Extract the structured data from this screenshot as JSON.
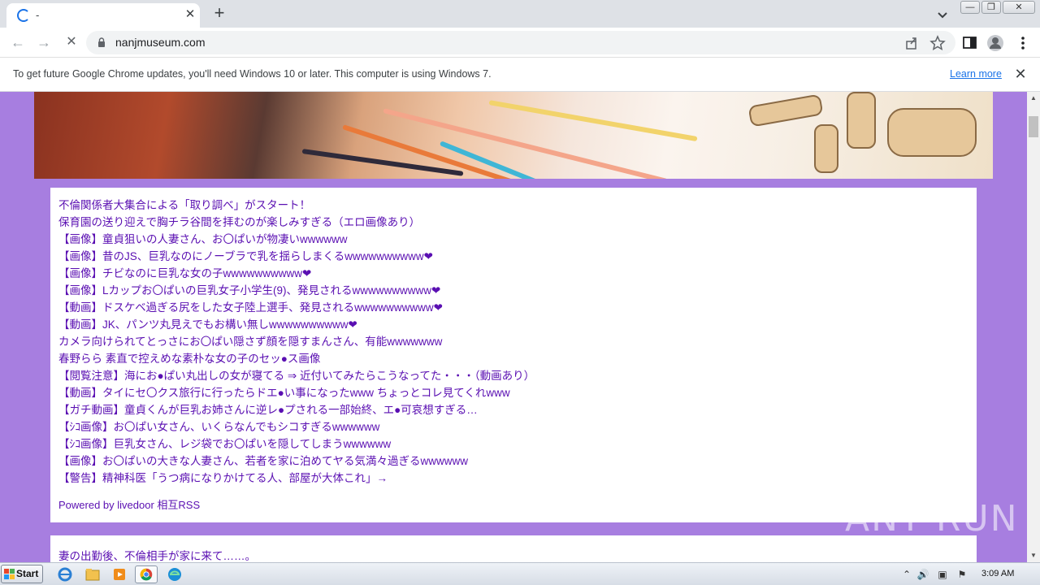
{
  "browser": {
    "tab_title": "-",
    "tab_close": "✕",
    "new_tab": "+",
    "url": "nanjmuseum.com",
    "back": "←",
    "forward": "→",
    "reload": "✕",
    "window_controls": {
      "minimize": "—",
      "restore": "❐",
      "close": "✕"
    }
  },
  "infobar": {
    "message": "To get future Google Chrome updates, you'll need Windows 10 or later. This computer is using Windows 7.",
    "link": "Learn more",
    "close": "✕"
  },
  "page": {
    "links": [
      "不倫関係者大集合による「取り調べ」がスタート！",
      "保育園の送り迎えで胸チラ谷間を拝むのが楽しみすぎる（エロ画像あり）",
      "【画像】童貞狙いの人妻さん、お〇ぱいが物凄いwwwwww",
      "【画像】昔のJS、巨乳なのにノーブラで乳を揺らしまくるwwwwwwwwww❤",
      "【画像】チビなのに巨乳な女の子wwwwwwwwww❤",
      "【画像】Lカップお〇ぱいの巨乳女子小学生(9)、発見されるwwwwwwwwww❤",
      "【動画】ドスケベ過ぎる尻をした女子陸上選手、発見されるwwwwwwwwww❤",
      "【動画】JK、パンツ丸見えでもお構い無しwwwwwwwwww❤",
      "カメラ向けられてとっさにお〇ぱい隠さず顔を隠すまんさん、有能wwwwwww",
      "春野らら 素直で控えめな素朴な女の子のセッ●ス画像",
      "【閲覧注意】海にお●ぱい丸出しの女が寝てる ⇒ 近付いてみたらこうなってた・・・（動画あり）",
      "【動画】タイにセ〇クス旅行に行ったらドエ●い事になったwww ちょっとコレ見てくれwww",
      "【ガチ動画】童貞くんが巨乳お姉さんに逆レ●プされる一部始終、エ●可哀想すぎる…",
      "【ｼｺ画像】お〇ぱい女さん、いくらなんでもシコすぎるwwwwww",
      "【ｼｺ画像】巨乳女さん、レジ袋でお〇ぱいを隠してしまうwwwwww",
      "【画像】お〇ぱいの大きな人妻さん、若者を家に泊めてヤる気満々過ぎるwwwwww",
      "【警告】精神科医「うつ病になりかけてる人、部屋が大体これ」→"
    ],
    "powered_by": "Powered by livedoor 相互RSS",
    "next_post": "妻の出勤後、不倫相手が家に来て……。",
    "watermark": "ANY RUN"
  },
  "taskbar": {
    "start": "Start",
    "clock": "3:09 AM"
  },
  "colors": {
    "page_background": "#a77ee0",
    "link": "#5a0fb2",
    "infobar_link": "#1a73e8"
  }
}
